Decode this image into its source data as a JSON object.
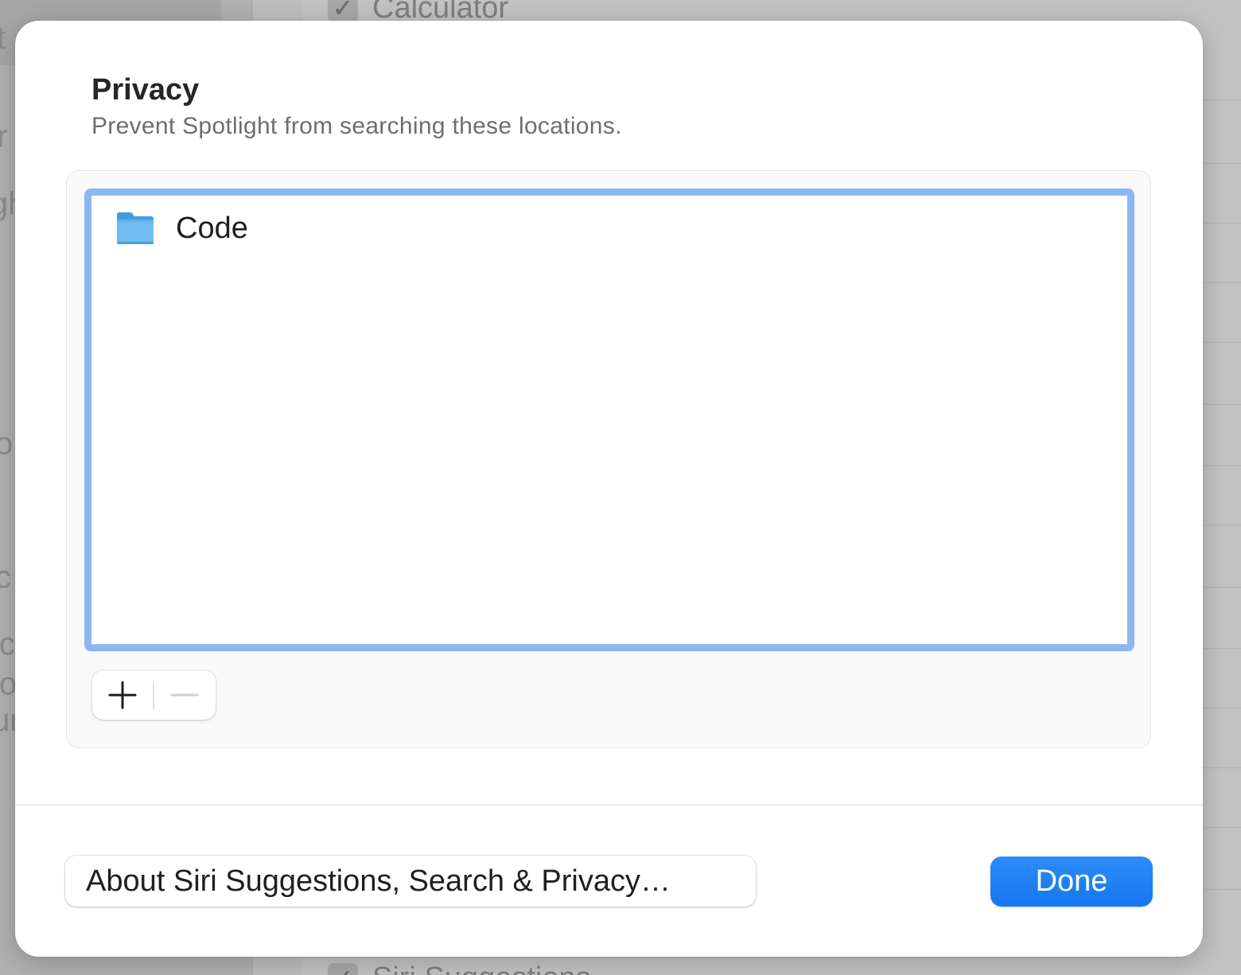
{
  "background": {
    "list_item_top": "Calculator",
    "list_item_bottom": "Siri Suggestions",
    "sidebar_fragments": [
      "t",
      "r",
      "gh",
      "o",
      "c",
      "ic",
      "lo",
      "ur"
    ]
  },
  "sheet": {
    "title": "Privacy",
    "subtitle": "Prevent Spotlight from searching these locations.",
    "excluded_locations": [
      {
        "name": "Code",
        "icon": "folder-icon"
      }
    ],
    "add_button_icon": "plus-icon",
    "remove_button_icon": "minus-icon",
    "about_button_label": "About Siri Suggestions, Search & Privacy…",
    "done_button_label": "Done"
  },
  "colors": {
    "accent": "#1677f0",
    "list_focus_ring": "#8db7f2",
    "folder": "#5fb4ea"
  }
}
